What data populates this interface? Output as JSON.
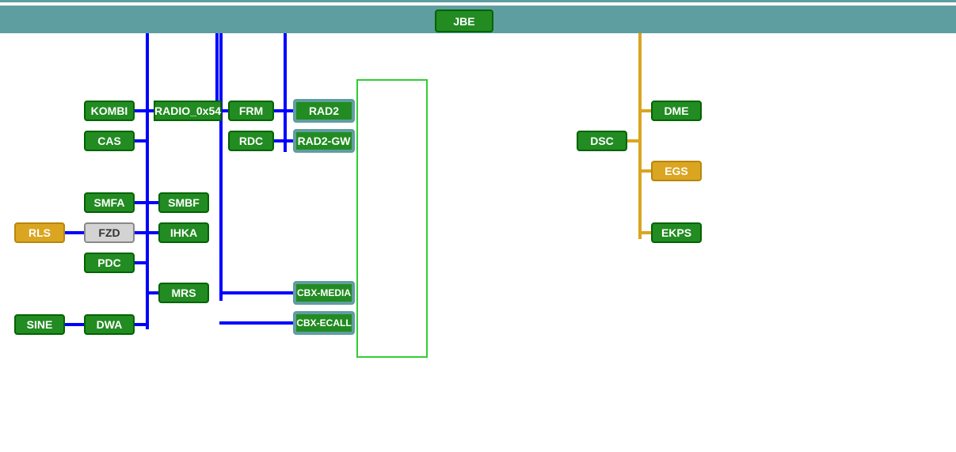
{
  "colors": {
    "green": "#228b22",
    "greenBorder": "#006400",
    "gold": "#daa520",
    "goldBorder": "#b8860b",
    "grey": "#d3d3d3",
    "greyBorder": "#888888",
    "teal": "#5f9ea0",
    "blue": "#0000ff",
    "lime": "#32cd32"
  },
  "header": {
    "jbe": "JBE"
  },
  "bus1": {
    "kombi": "KOMBI",
    "radio": "RADIO_0x54",
    "cas": "CAS",
    "smfa": "SMFA",
    "smbf": "SMBF",
    "fzd": "FZD",
    "ihka": "IHKA",
    "pdc": "PDC",
    "mrs": "MRS",
    "sine": "SINE",
    "dwa": "DWA",
    "rls": "RLS"
  },
  "bus2": {
    "frm": "FRM",
    "rdc": "RDC"
  },
  "bus3": {
    "rad2": "RAD2",
    "rad2gw": "RAD2-GW",
    "cbxmedia": "CBX-MEDIA",
    "cbxecall": "CBX-ECALL"
  },
  "bus4": {
    "dsc": "DSC",
    "dme": "DME",
    "egs": "EGS",
    "ekps": "EKPS"
  }
}
